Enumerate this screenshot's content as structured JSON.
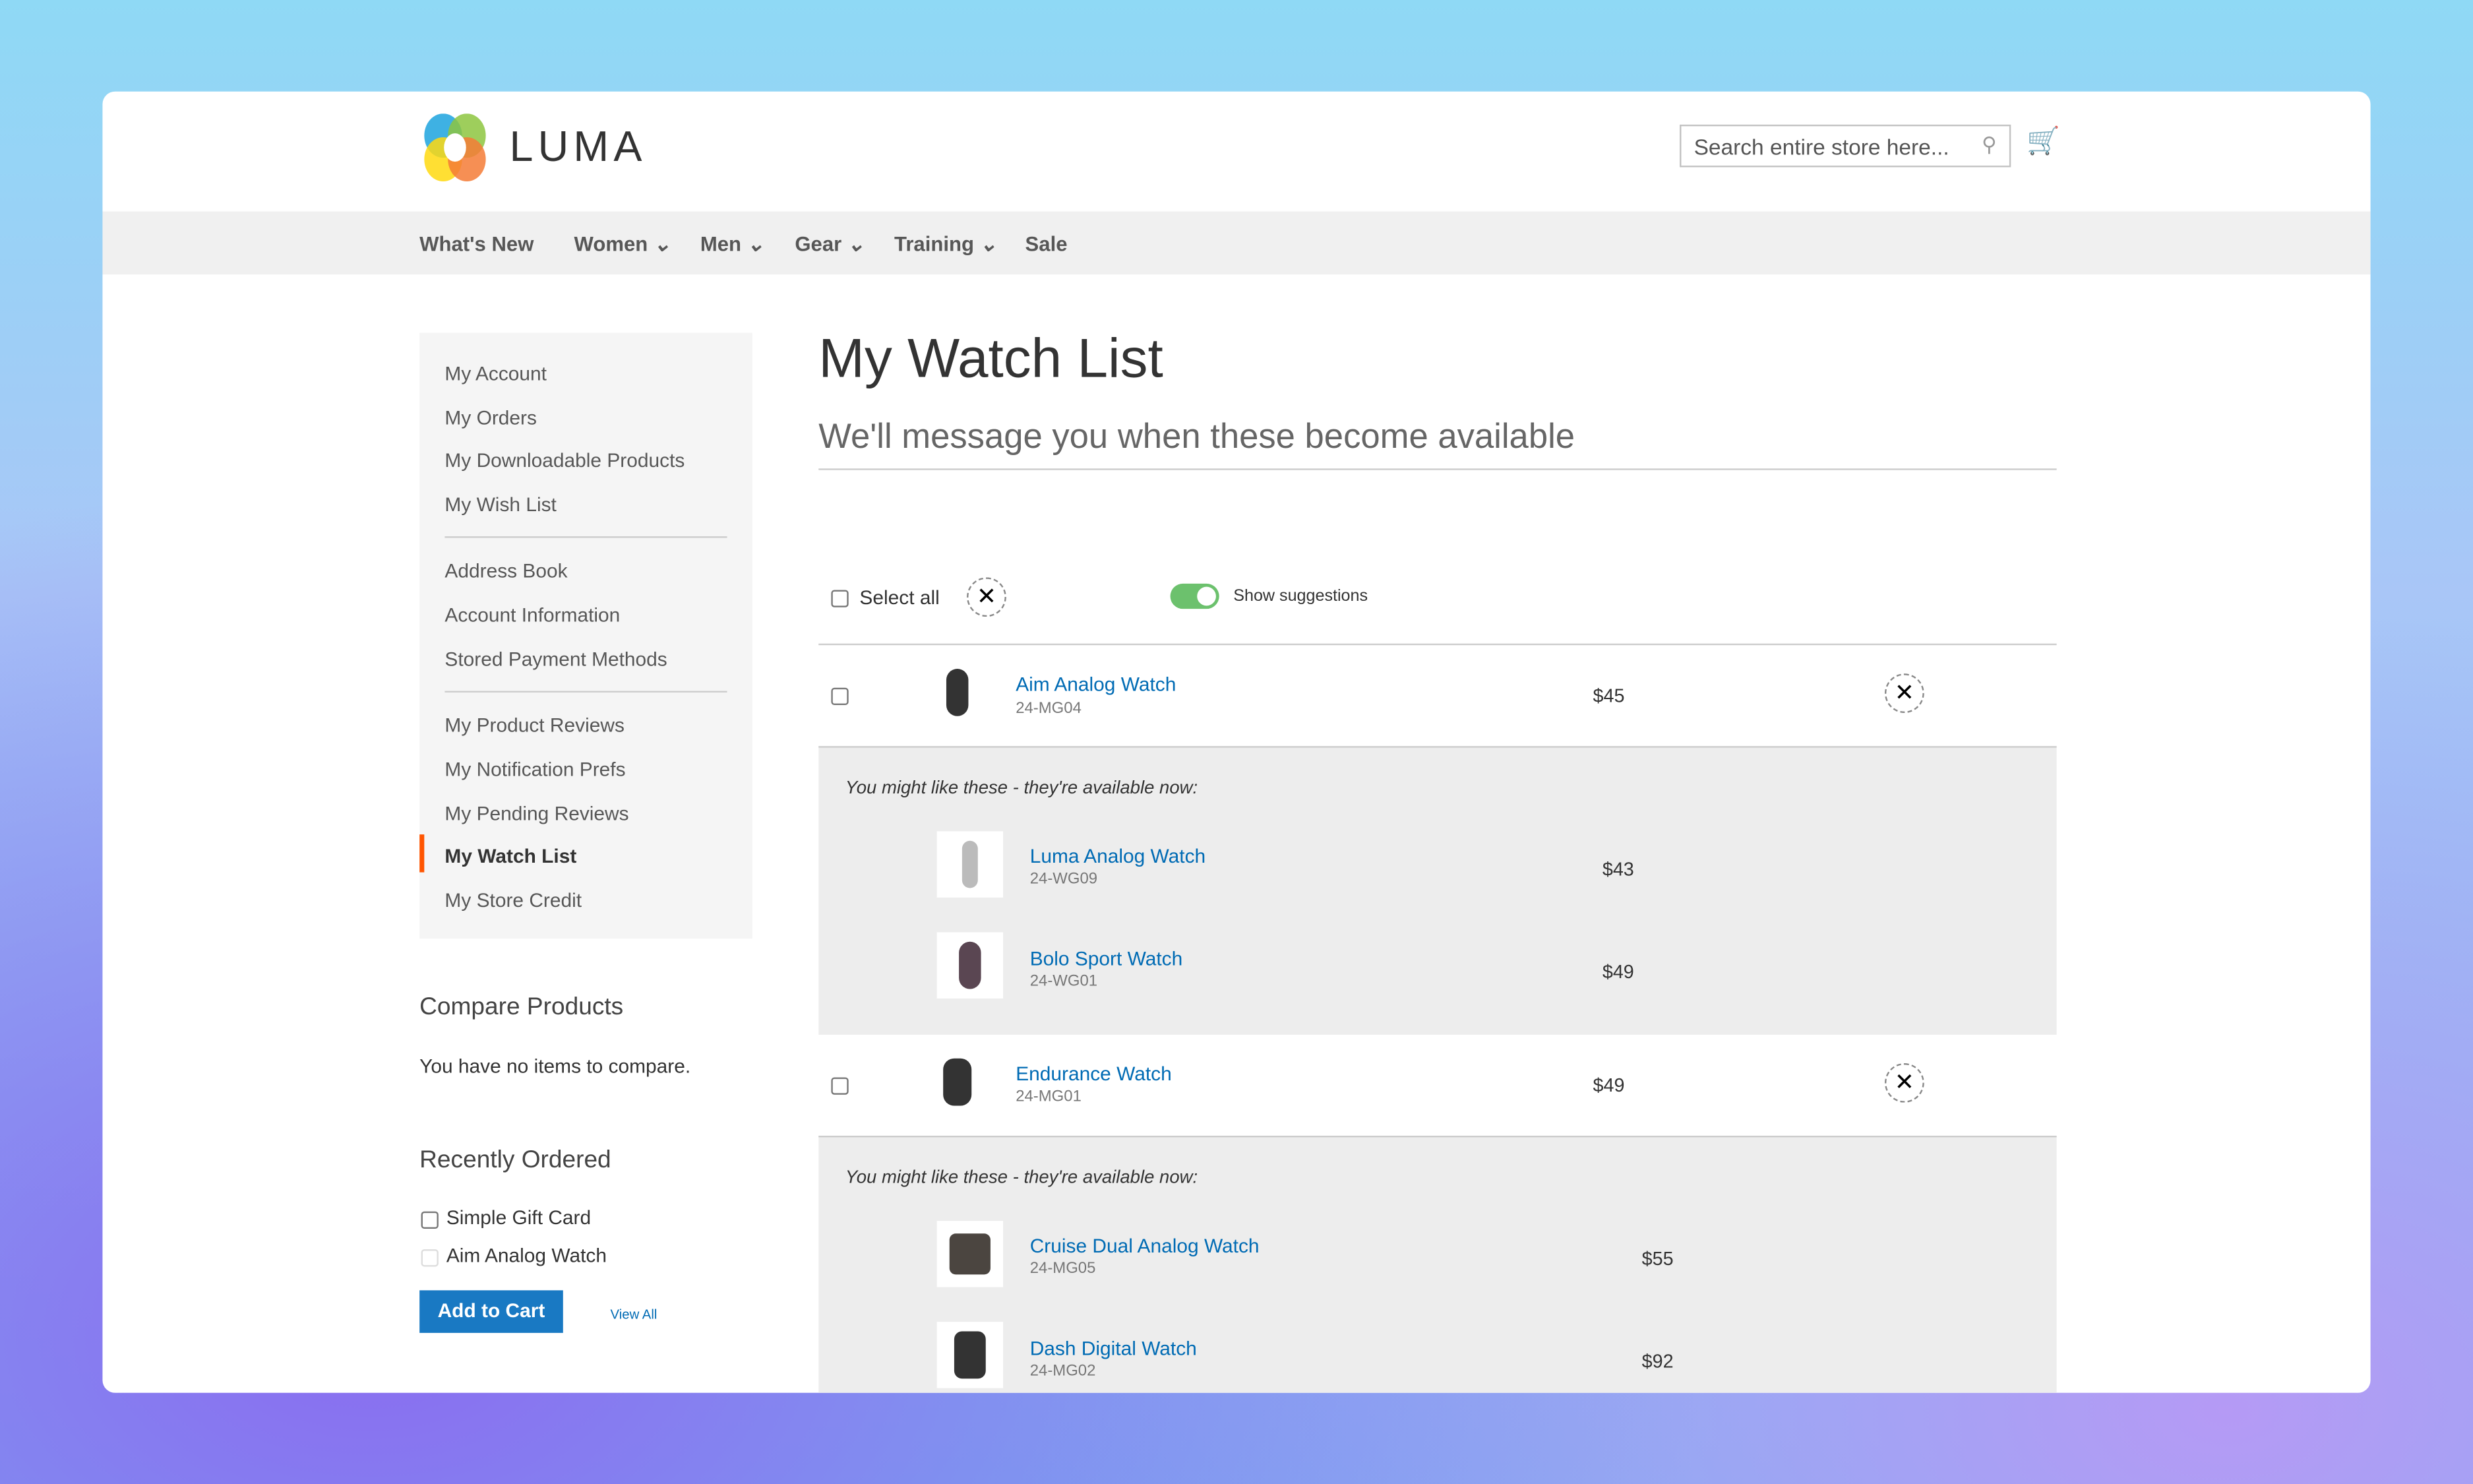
{
  "header": {
    "logo_text": "LUMA",
    "search_placeholder": "Search entire store here...",
    "search_icon": "magnifier-icon",
    "cart_icon": "cart-icon"
  },
  "nav": [
    "What's New",
    "Women",
    "Men",
    "Gear",
    "Training",
    "Sale"
  ],
  "sidebar": {
    "group1": [
      "My Account",
      "My Orders",
      "My Downloadable Products",
      "My Wish List"
    ],
    "group2": [
      "Address Book",
      "Account Information",
      "Stored Payment Methods"
    ],
    "group3": [
      "My Product Reviews",
      "My Notification Prefs",
      "My Pending Reviews",
      "My Watch List",
      "My Store Credit"
    ],
    "active": "My Watch List",
    "accent": "#ff5501"
  },
  "compare": {
    "title": "Compare Products",
    "text": "You have no items to compare."
  },
  "recent": {
    "title": "Recently Ordered",
    "items": [
      "Simple Gift Card",
      "Aim Analog Watch"
    ],
    "add_to_cart": "Add to Cart",
    "view_all": "View All"
  },
  "main": {
    "title": "My Watch List",
    "subtitle": "We'll message you when these become available",
    "select_all": "Select all",
    "show_suggestions": "Show suggestions",
    "suggestions_on": true,
    "suggest_label": "You might like these - they're available now:",
    "items": [
      {
        "name": "Aim Analog Watch",
        "sku": "24-MG04",
        "price": "$45",
        "suggestions": [
          {
            "name": "Luma Analog Watch",
            "sku": "24-WG09",
            "price": "$43"
          },
          {
            "name": "Bolo Sport Watch",
            "sku": "24-WG01",
            "price": "$49"
          }
        ]
      },
      {
        "name": "Endurance Watch",
        "sku": "24-MG01",
        "price": "$49",
        "suggestions": [
          {
            "name": "Cruise Dual Analog Watch",
            "sku": "24-MG05",
            "price": "$55"
          },
          {
            "name": "Dash Digital Watch",
            "sku": "24-MG02",
            "price": "$92"
          }
        ]
      }
    ]
  }
}
